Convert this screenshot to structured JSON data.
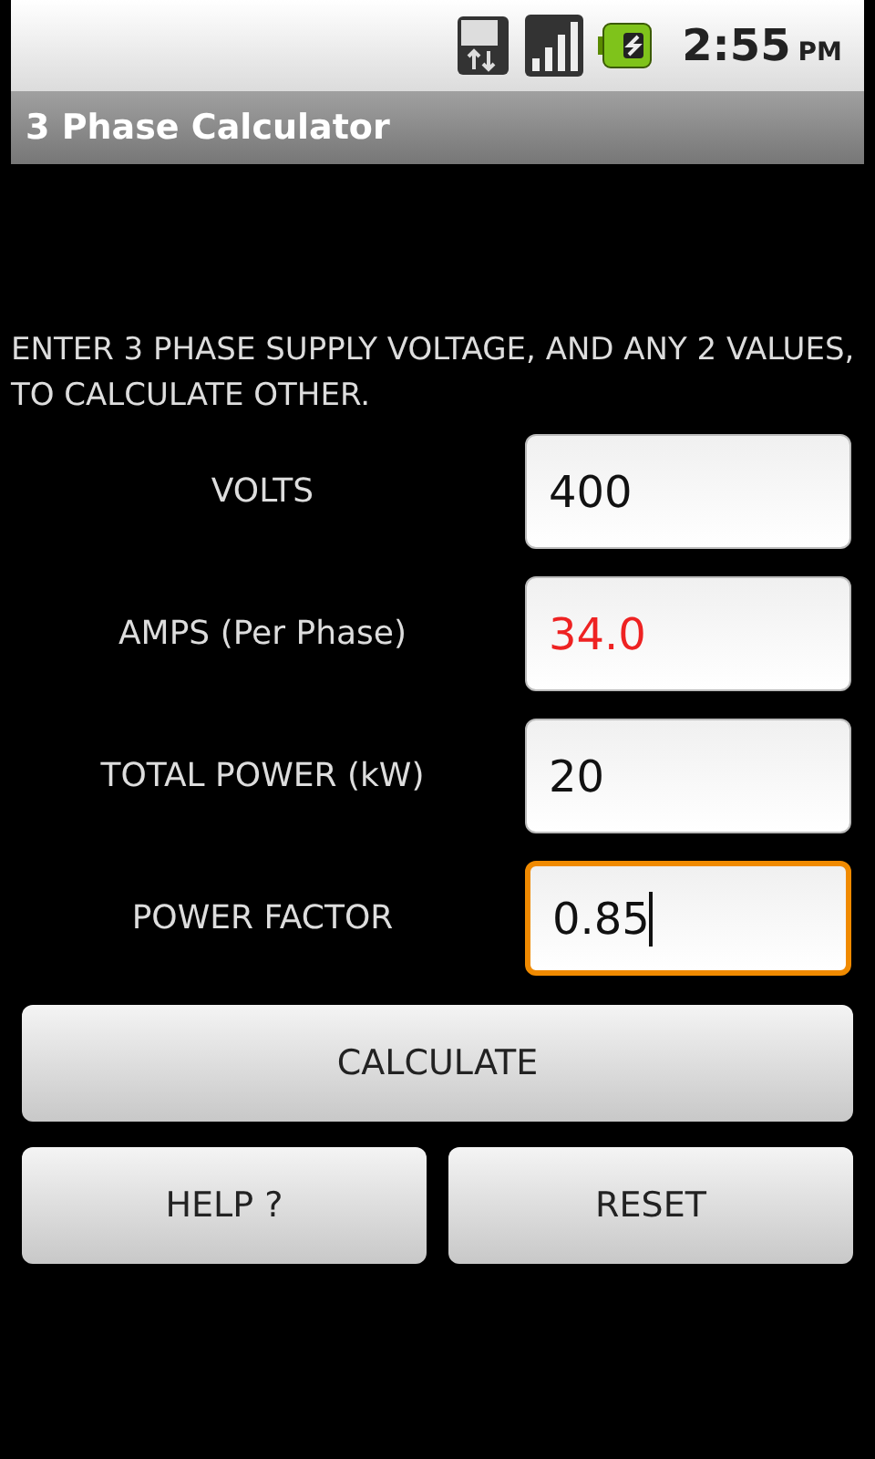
{
  "status_bar": {
    "time": "2:55",
    "ampm": "PM"
  },
  "title": "3 Phase Calculator",
  "instructions": "ENTER 3 PHASE SUPPLY VOLTAGE, AND ANY 2 VALUES, TO CALCULATE OTHER.",
  "fields": [
    {
      "label": "VOLTS",
      "value": "400",
      "calculated": false,
      "focused": false
    },
    {
      "label": "AMPS (Per Phase)",
      "value": "34.0",
      "calculated": true,
      "focused": false
    },
    {
      "label": "TOTAL POWER (kW)",
      "value": "20",
      "calculated": false,
      "focused": false
    },
    {
      "label": "POWER FACTOR",
      "value": "0.85",
      "calculated": false,
      "focused": true
    }
  ],
  "buttons": [
    "CALCULATE",
    "HELP ?",
    "RESET"
  ]
}
